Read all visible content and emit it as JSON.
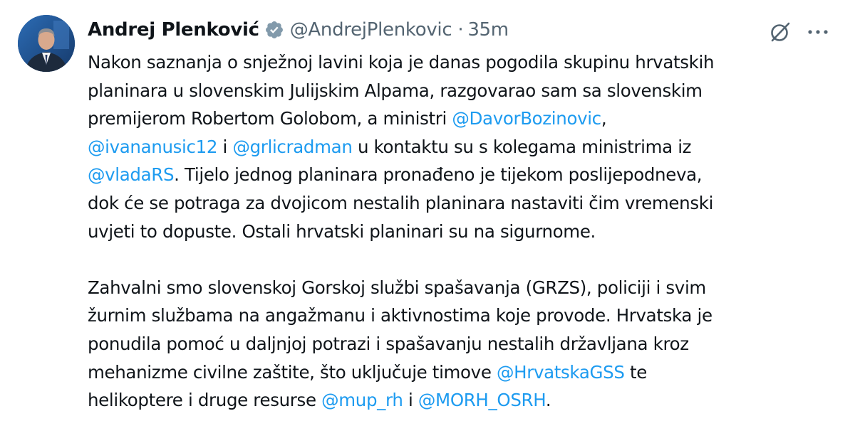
{
  "author": {
    "name": "Andrej Plenković",
    "handle": "@AndrejPlenkovic",
    "separator": "·",
    "time": "35m",
    "verified_badge_color": "#829aab"
  },
  "icons": {
    "avatar": "profile-photo",
    "verified": "verified-badge-icon",
    "grok": "grok-icon",
    "more": "more-options-icon"
  },
  "colors": {
    "mention": "#1d9bf0",
    "text": "#0f1419",
    "secondary": "#536471"
  },
  "tweet": {
    "p1": {
      "l1": "Nakon saznanja o snježnoj lavini koja je danas pogodila skupinu hrvatskih",
      "l2": "planinara u slovenskim Julijskim Alpama, razgovarao sam sa slovenskim",
      "l3a": "premijerom Robertom Golobom, a ministri ",
      "l3m1": "@DavorBozinovic",
      "l3b": ",",
      "l4m1": "@ivananusic12",
      "l4a": " i ",
      "l4m2": "@grlicradman",
      "l4b": " u kontaktu su s kolegama ministrima iz",
      "l5m1": "@vladaRS",
      "l5a": ". Tijelo jednog planinara pronađeno je tijekom poslijepodneva,",
      "l6": "dok će se potraga za dvojicom nestalih planinara nastaviti čim vremenski",
      "l7": "uvjeti to dopuste. Ostali hrvatski planinari su na sigurnome."
    },
    "p2": {
      "l1": "Zahvalni smo slovenskoj Gorskoj službi spašavanja (GRZS), policiji i svim",
      "l2": "žurnim službama na angažmanu i aktivnostima koje provode. Hrvatska je",
      "l3": "ponudila pomoć u daljnjoj potrazi i spašavanju nestalih državljana kroz",
      "l4a": "mehanizme civilne zaštite, što uključuje timove ",
      "l4m1": "@HrvatskaGSS",
      "l4b": " te",
      "l5a": "helikoptere i druge resurse ",
      "l5m1": "@mup_rh",
      "l5b": " i ",
      "l5m2": "@MORH_OSRH",
      "l5c": "."
    }
  }
}
